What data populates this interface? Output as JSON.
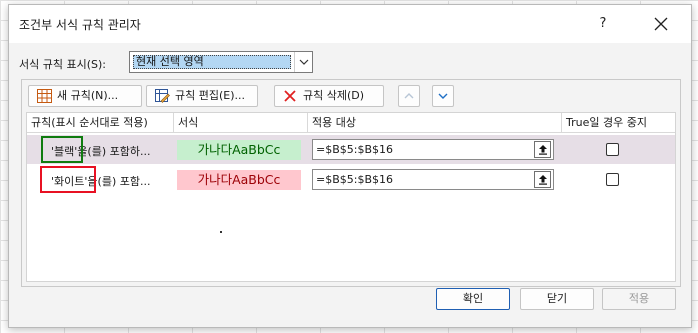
{
  "dialog": {
    "title": "조건부 서식 규칙 관리자",
    "help_label": "?"
  },
  "scope": {
    "label": "서식 규칙 표시(S):",
    "selected": "현재 선택 영역"
  },
  "toolbar": {
    "new_rule": "새 규칙(N)...",
    "edit_rule": "규칙 편집(E)...",
    "delete_rule": "규칙 삭제(D)"
  },
  "table": {
    "columns": [
      "규칙(표시 순서대로 적용)",
      "서식",
      "적용 대상",
      "True일 경우 중지"
    ],
    "rows": [
      {
        "rule": "'블랙'을(를) 포함하...",
        "format_preview": "가나다AaBbCc",
        "applies_to": "=$B$5:$B$16",
        "stop_if_true": false,
        "selected": true
      },
      {
        "rule": "'화이트'을(를) 포함...",
        "format_preview": "가나다AaBbCc",
        "applies_to": "=$B$5:$B$16",
        "stop_if_true": false,
        "selected": false
      }
    ]
  },
  "buttons": {
    "ok": "확인",
    "close": "닫기",
    "apply": "적용"
  },
  "colors": {
    "selected_row": "#e6dee6",
    "green_preview_bg": "#c6efce",
    "green_preview_text": "#006100",
    "red_preview_bg": "#ffc7ce",
    "red_preview_text": "#9c0006",
    "highlight_green": "#107c10",
    "highlight_red": "#e81123",
    "primary_button_border": "#1f5fb3"
  }
}
